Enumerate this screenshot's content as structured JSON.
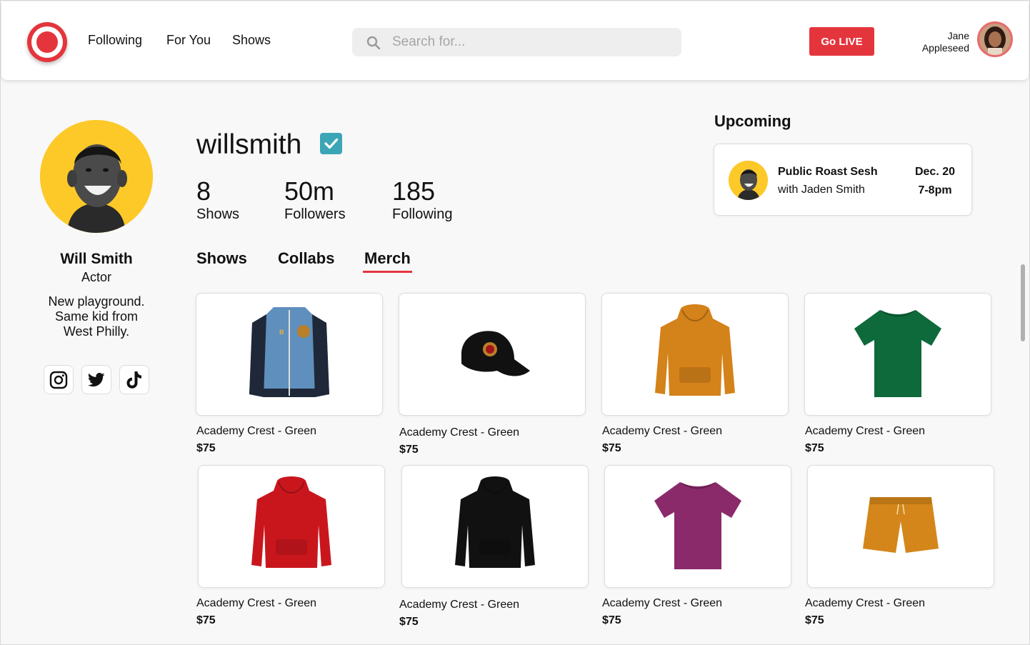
{
  "header": {
    "nav": [
      "Following",
      "For You",
      "Shows"
    ],
    "search_placeholder": "Search for...",
    "go_live": "Go LIVE",
    "user": {
      "first": "Jane",
      "last": "Appleseed"
    }
  },
  "profile": {
    "handle": "willsmith",
    "name": "Will Smith",
    "role": "Actor",
    "bio": [
      "New playground.",
      "Same kid from",
      "West Philly."
    ],
    "stats": [
      {
        "value": "8",
        "label": "Shows"
      },
      {
        "value": "50m",
        "label": "Followers"
      },
      {
        "value": "185",
        "label": "Following"
      }
    ],
    "socials": [
      "instagram-icon",
      "twitter-icon",
      "tiktok-icon"
    ]
  },
  "tabs": [
    "Shows",
    "Collabs",
    "Merch"
  ],
  "active_tab": "Merch",
  "upcoming": {
    "title": "Upcoming",
    "event": "Public Roast Sesh",
    "with": "with Jaden Smith",
    "date": "Dec. 20",
    "time": "7-8pm"
  },
  "merch": [
    {
      "name": "Academy Crest - Green",
      "price": "$75",
      "kind": "varsity-jacket",
      "color": "#5f8fbd"
    },
    {
      "name": "Academy Crest - Green",
      "price": "$75",
      "kind": "cap",
      "color": "#111111"
    },
    {
      "name": "Academy Crest - Green",
      "price": "$75",
      "kind": "hoodie",
      "color": "#d4821a"
    },
    {
      "name": "Academy Crest - Green",
      "price": "$75",
      "kind": "tshirt",
      "color": "#0e6a3a"
    },
    {
      "name": "Academy Crest - Green",
      "price": "$75",
      "kind": "hoodie",
      "color": "#c9161d"
    },
    {
      "name": "Academy Crest - Green",
      "price": "$75",
      "kind": "hoodie",
      "color": "#111111"
    },
    {
      "name": "Academy Crest - Green",
      "price": "$75",
      "kind": "tshirt",
      "color": "#8a2a6a"
    },
    {
      "name": "Academy Crest - Green",
      "price": "$75",
      "kind": "shorts",
      "color": "#d4861a"
    }
  ],
  "colors": {
    "accent": "#e4353c",
    "verified": "#3ca6b6",
    "avatar_bg": "#fdc928"
  }
}
